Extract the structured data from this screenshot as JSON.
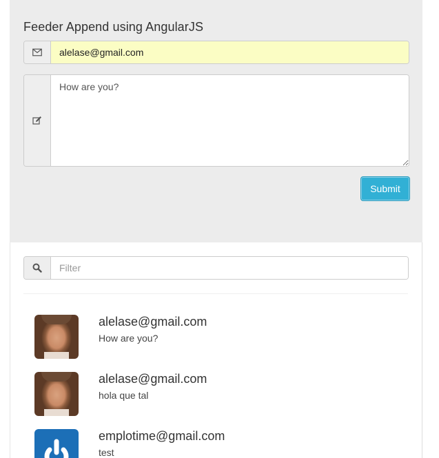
{
  "form": {
    "title": "Feeder Append using AngularJS",
    "email_icon": "envelope-icon",
    "email_value": "alelase@gmail.com",
    "message_icon": "edit-icon",
    "message_value": "How are you?",
    "submit_label": "Submit"
  },
  "filter": {
    "icon": "search-icon",
    "placeholder": "Filter"
  },
  "feed": [
    {
      "email": "alelase@gmail.com",
      "message": "How are you?",
      "avatar": "user-photo"
    },
    {
      "email": "alelase@gmail.com",
      "message": "hola que tal",
      "avatar": "user-photo"
    },
    {
      "email": "emplotime@gmail.com",
      "message": "test",
      "avatar": "power-logo"
    }
  ],
  "colors": {
    "accent": "#31b0d5",
    "panel_bg": "#ececec",
    "autofill_bg": "#fbfdc4",
    "logo_bg": "#1c6fb7"
  }
}
